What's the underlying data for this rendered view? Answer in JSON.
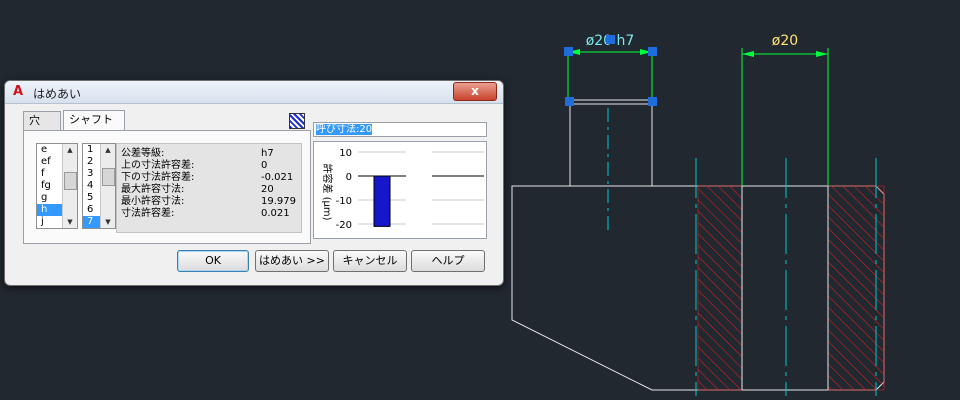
{
  "cad": {
    "dim_shaft": "ø20 h7",
    "dim_hole": "ø20"
  },
  "colors": {
    "background": "#212830",
    "dimension_green": "#00ff3c",
    "grip_blue": "#1e6ddb",
    "center_cyan": "#00c8d2",
    "hatch_red": "#d22020"
  },
  "dialog": {
    "title": "はめあい",
    "app_icon": "A",
    "close_label": "x",
    "tabs": [
      {
        "label": "穴"
      },
      {
        "label": "シャフト"
      }
    ],
    "grade_list": [
      "e",
      "ef",
      "f",
      "fg",
      "g",
      "h",
      "j"
    ],
    "grade_selected": "h",
    "number_list": [
      "1",
      "2",
      "3",
      "4",
      "5",
      "6",
      "7"
    ],
    "number_selected": "7",
    "info_rows": [
      {
        "label": "公差等級:",
        "value": "h7"
      },
      {
        "label": "上の寸法許容差:",
        "value": "0"
      },
      {
        "label": "下の寸法許容差:",
        "value": "-0.021"
      },
      {
        "label": "最大許容寸法:",
        "value": "20"
      },
      {
        "label": "最小許容寸法:",
        "value": "19.979"
      },
      {
        "label": "寸法許容差:",
        "value": "0.021"
      }
    ],
    "nominal_label": "呼び寸法:20",
    "graph": {
      "ylabel": "許容差 (μm)",
      "ticks": [
        "10",
        "0",
        "-10",
        "-20"
      ],
      "upper_deviation_um": 0,
      "lower_deviation_um": -21
    },
    "buttons": {
      "ok": "OK",
      "fit": "はめあい >>",
      "cancel": "キャンセル",
      "help": "ヘルプ"
    }
  }
}
